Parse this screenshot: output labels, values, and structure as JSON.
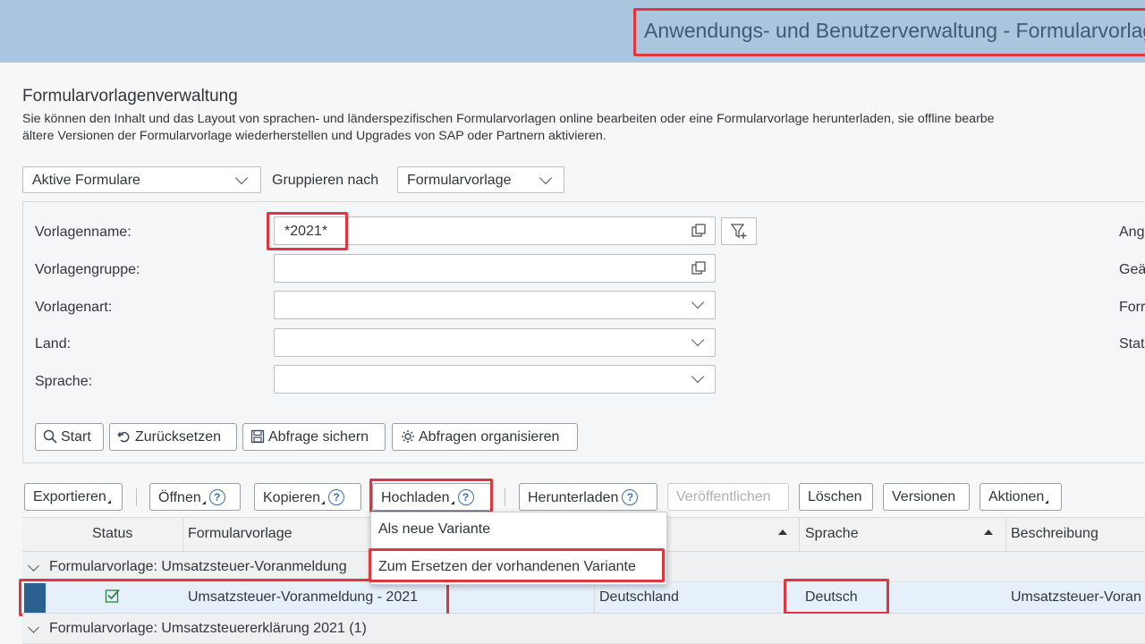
{
  "header": {
    "title": "Anwendungs- und Benutzerverwaltung - Formularvorlage"
  },
  "page": {
    "title": "Formularvorlagenverwaltung",
    "description_line1": "Sie können den Inhalt und das Layout von sprachen- und länderspezifischen Formularvorlagen online bearbeiten oder eine Formularvorlage herunterladen, sie offline bearbe",
    "description_line2": "ältere Versionen der Formularvorlage wiederherstellen und Upgrades von SAP oder Partnern aktivieren."
  },
  "view_select": {
    "value": "Aktive Formulare"
  },
  "group_by": {
    "label": "Gruppieren nach",
    "value": "Formularvorlage"
  },
  "filters": {
    "template_name": {
      "label": "Vorlagenname:",
      "value": "*2021*"
    },
    "template_group": {
      "label": "Vorlagengruppe:",
      "value": ""
    },
    "template_type": {
      "label": "Vorlagenart:",
      "value": ""
    },
    "country": {
      "label": "Land:",
      "value": ""
    },
    "language": {
      "label": "Sprache:",
      "value": ""
    },
    "right_labels": [
      "Ang",
      "Geä",
      "Forr",
      "Stat"
    ]
  },
  "filter_buttons": {
    "start": "Start",
    "reset": "Zurücksetzen",
    "save_query": "Abfrage sichern",
    "organize_queries": "Abfragen organisieren"
  },
  "toolbar": {
    "export": "Exportieren",
    "open": "Öffnen",
    "copy": "Kopieren",
    "upload": "Hochladen",
    "download": "Herunterladen",
    "publish": "Veröffentlichen",
    "delete": "Löschen",
    "versions": "Versionen",
    "actions": "Aktionen",
    "help_glyph": "?"
  },
  "upload_menu": {
    "items": [
      "Als neue Variante",
      "Zum Ersetzen der vorhandenen Variante"
    ]
  },
  "table": {
    "columns": {
      "status": "Status",
      "template": "Formularvorlage",
      "language": "Sprache",
      "description": "Beschreibung"
    },
    "groups": [
      "Formularvorlage: Umsatzsteuer-Voranmeldung",
      "Formularvorlage: Umsatzsteuererklärung 2021 (1)"
    ],
    "rows": [
      {
        "template": "Umsatzsteuer-Voranmeldung - 2021",
        "country": "Deutschland",
        "language": "Deutsch",
        "description": "Umsatzsteuer-Voran"
      }
    ]
  },
  "colors": {
    "header_bg": "#aac6df",
    "highlight": "#e0363e",
    "selected_row": "#e5f0fa",
    "row_marker": "#2b5f8f",
    "status_ok": "#2e8540"
  }
}
